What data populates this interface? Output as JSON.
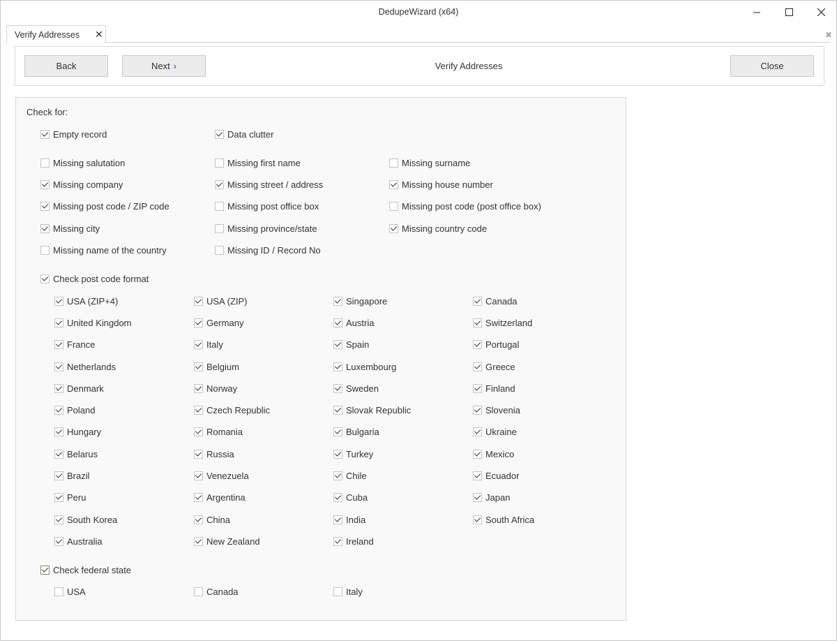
{
  "window": {
    "title": "DedupeWizard  (x64)",
    "minimize": "minimize",
    "maximize": "maximize",
    "close": "close"
  },
  "tab": {
    "label": "Verify Addresses"
  },
  "toolbar": {
    "back_label": "Back",
    "next_label": "Next",
    "title": "Verify Addresses",
    "close_label": "Close"
  },
  "check_for": {
    "label": "Check for:",
    "general": [
      {
        "label": "Empty record",
        "checked": true
      },
      {
        "label": "Data clutter",
        "checked": true
      }
    ],
    "missing": [
      {
        "label": "Missing salutation",
        "checked": false
      },
      {
        "label": "Missing first name",
        "checked": false
      },
      {
        "label": "Missing surname",
        "checked": false
      },
      {
        "label": "Missing company",
        "checked": true
      },
      {
        "label": "Missing street / address",
        "checked": true
      },
      {
        "label": "Missing house number",
        "checked": true
      },
      {
        "label": "Missing post code / ZIP code",
        "checked": true
      },
      {
        "label": "Missing post office box",
        "checked": false
      },
      {
        "label": "Missing post code (post office box)",
        "checked": false
      },
      {
        "label": "Missing city",
        "checked": true
      },
      {
        "label": "Missing province/state",
        "checked": false
      },
      {
        "label": "Missing country code",
        "checked": true
      },
      {
        "label": "Missing name of the country",
        "checked": false
      },
      {
        "label": "Missing ID / Record No",
        "checked": false
      }
    ],
    "post_code_format": {
      "label": "Check post code format",
      "checked": true,
      "countries": [
        {
          "label": "USA (ZIP+4)",
          "checked": true
        },
        {
          "label": "USA (ZIP)",
          "checked": true
        },
        {
          "label": "Singapore",
          "checked": true
        },
        {
          "label": "Canada",
          "checked": true
        },
        {
          "label": "United Kingdom",
          "checked": true
        },
        {
          "label": "Germany",
          "checked": true
        },
        {
          "label": "Austria",
          "checked": true
        },
        {
          "label": "Switzerland",
          "checked": true
        },
        {
          "label": "France",
          "checked": true
        },
        {
          "label": "Italy",
          "checked": true
        },
        {
          "label": "Spain",
          "checked": true
        },
        {
          "label": "Portugal",
          "checked": true
        },
        {
          "label": "Netherlands",
          "checked": true
        },
        {
          "label": "Belgium",
          "checked": true
        },
        {
          "label": "Luxembourg",
          "checked": true
        },
        {
          "label": "Greece",
          "checked": true
        },
        {
          "label": "Denmark",
          "checked": true
        },
        {
          "label": "Norway",
          "checked": true
        },
        {
          "label": "Sweden",
          "checked": true
        },
        {
          "label": "Finland",
          "checked": true
        },
        {
          "label": "Poland",
          "checked": true
        },
        {
          "label": "Czech Republic",
          "checked": true
        },
        {
          "label": "Slovak Republic",
          "checked": true
        },
        {
          "label": "Slovenia",
          "checked": true
        },
        {
          "label": "Hungary",
          "checked": true
        },
        {
          "label": "Romania",
          "checked": true
        },
        {
          "label": "Bulgaria",
          "checked": true
        },
        {
          "label": "Ukraine",
          "checked": true
        },
        {
          "label": "Belarus",
          "checked": true
        },
        {
          "label": "Russia",
          "checked": true
        },
        {
          "label": "Turkey",
          "checked": true
        },
        {
          "label": "Mexico",
          "checked": true
        },
        {
          "label": "Brazil",
          "checked": true
        },
        {
          "label": "Venezuela",
          "checked": true
        },
        {
          "label": "Chile",
          "checked": true
        },
        {
          "label": "Ecuador",
          "checked": true
        },
        {
          "label": "Peru",
          "checked": true
        },
        {
          "label": "Argentina",
          "checked": true
        },
        {
          "label": "Cuba",
          "checked": true
        },
        {
          "label": "Japan",
          "checked": true
        },
        {
          "label": "South Korea",
          "checked": true
        },
        {
          "label": "China",
          "checked": true
        },
        {
          "label": "India",
          "checked": true
        },
        {
          "label": "South Africa",
          "checked": true
        },
        {
          "label": "Australia",
          "checked": true
        },
        {
          "label": "New Zealand",
          "checked": true
        },
        {
          "label": "Ireland",
          "checked": true
        }
      ]
    },
    "federal_state": {
      "label": "Check federal state",
      "checked": true,
      "countries": [
        {
          "label": "USA",
          "checked": false
        },
        {
          "label": "Canada",
          "checked": false
        },
        {
          "label": "Italy",
          "checked": false
        }
      ]
    }
  }
}
